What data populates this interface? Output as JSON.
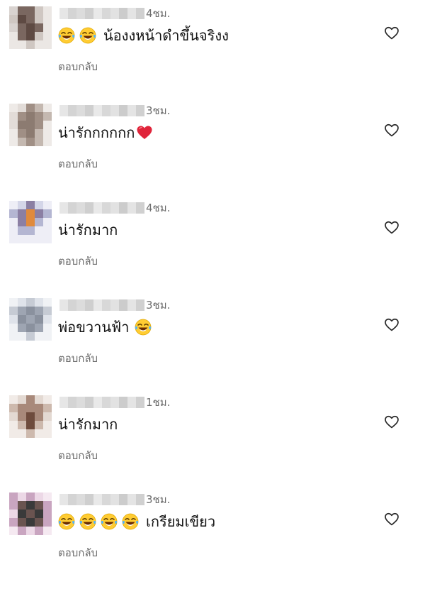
{
  "comments": [
    {
      "time": "4ชม.",
      "emoji_prefix_count": 2,
      "emoji_suffix_count": 0,
      "text": "น้องงหน้าดำขึ้นจริงง",
      "heart_suffix": false,
      "reply_label": "ตอบกลับ",
      "like_icon": "heart-outline-icon",
      "avatar_palette": [
        "#d9d3d0",
        "#7a6760",
        "#5e4a43",
        "#cfc7c2",
        "#ebe7e4"
      ]
    },
    {
      "time": "3ชม.",
      "emoji_prefix_count": 0,
      "emoji_suffix_count": 0,
      "text": "น่ารักกกกกก",
      "heart_suffix": true,
      "reply_label": "ตอบกลับ",
      "like_icon": "heart-outline-icon",
      "avatar_palette": [
        "#e2dcd8",
        "#a08f85",
        "#8c7b71",
        "#c4b8b0",
        "#eeeae7"
      ]
    },
    {
      "time": "4ชม.",
      "emoji_prefix_count": 0,
      "emoji_suffix_count": 0,
      "text": "น่ารักมาก",
      "heart_suffix": false,
      "reply_label": "ตอบกลับ",
      "like_icon": "heart-outline-icon",
      "avatar_palette": [
        "#d4d6e8",
        "#8b7fa3",
        "#e08a3c",
        "#b4b6d2",
        "#eeeef6"
      ]
    },
    {
      "time": "3ชม.",
      "emoji_prefix_count": 0,
      "emoji_suffix_count": 1,
      "text": "พ่อขวานฟ้า",
      "heart_suffix": false,
      "reply_label": "ตอบกลับ",
      "like_icon": "heart-outline-icon",
      "avatar_palette": [
        "#dfe3ea",
        "#9ea5b2",
        "#8a919e",
        "#c6cbd4",
        "#f0f2f5"
      ]
    },
    {
      "time": "1ชม.",
      "emoji_prefix_count": 0,
      "emoji_suffix_count": 0,
      "text": "น่ารักมาก",
      "heart_suffix": false,
      "reply_label": "ตอบกลับ",
      "like_icon": "heart-outline-icon",
      "avatar_palette": [
        "#e3d9d2",
        "#a8897a",
        "#6e4b3c",
        "#cdb9ad",
        "#f1ebe7"
      ]
    },
    {
      "time": "3ชม.",
      "emoji_prefix_count": 4,
      "emoji_suffix_count": 0,
      "text": "เกรียมเขียว",
      "heart_suffix": false,
      "reply_label": "ตอบกลับ",
      "like_icon": "heart-outline-icon",
      "avatar_palette": [
        "#ecd8e6",
        "#6a5450",
        "#3a3a3a",
        "#c9a5c0",
        "#f5e9f1"
      ]
    }
  ],
  "colors": {
    "text": "#111111",
    "secondary": "#6e6e6e",
    "heart_red": "#e0243a",
    "emoji_yellow": "#ffcc33",
    "tear_blue": "#4fb3ff"
  }
}
